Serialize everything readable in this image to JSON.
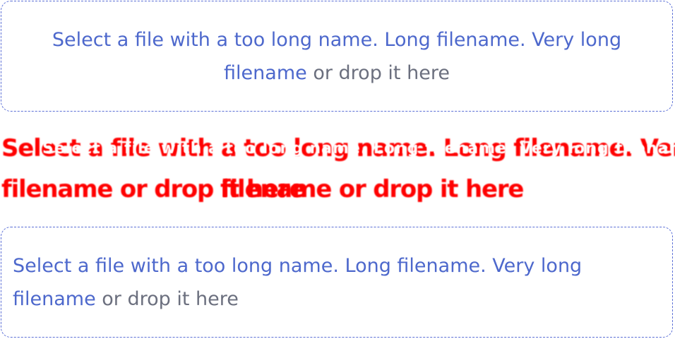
{
  "dropzone_top": {
    "link_text": "Select a file with a too long name. Long filename. Very long filename",
    "suffix_text": " or drop it here"
  },
  "glitch_text": {
    "line1": "Select a file with a too long name. Long filename. Very long",
    "line2": "filename or drop it here",
    "line1_overlay": "Select a file with a too long name. Long filename. Very long filename",
    "line2_overlay": "filename or drop it here"
  },
  "dropzone_bottom": {
    "link_text": "Select a file with a too long name. Long filename. Very long filename",
    "suffix_text": " or drop it here"
  }
}
